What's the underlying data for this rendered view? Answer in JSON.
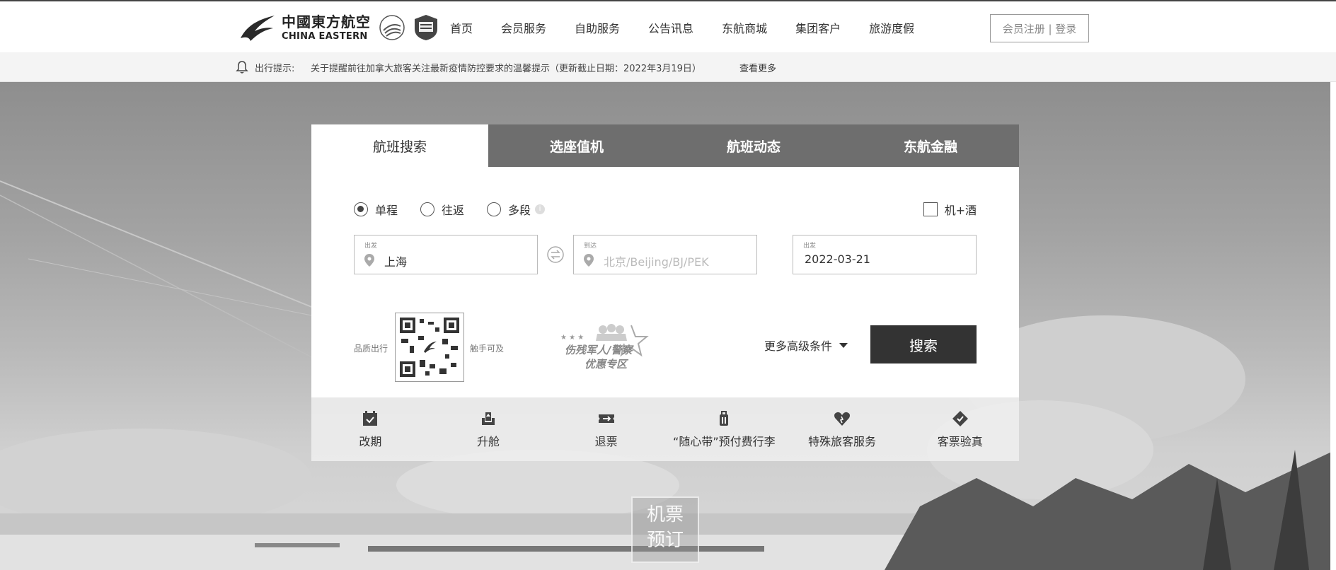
{
  "brand": {
    "name_cn": "中國東方航空",
    "name_en": "CHINA EASTERN"
  },
  "nav": {
    "items": [
      "首页",
      "会员服务",
      "自助服务",
      "公告讯息",
      "东航商城",
      "集团客户",
      "旅游度假"
    ],
    "login": "会员注册 | 登录"
  },
  "notice": {
    "label": "出行提示:",
    "text": "关于提醒前往加拿大旅客关注最新疫情防控要求的温馨提示（更新截止日期：2022年3月19日）",
    "more": "查看更多"
  },
  "search": {
    "tabs": [
      "航班搜索",
      "选座值机",
      "航班动态",
      "东航金融"
    ],
    "active_tab": 0,
    "trip_types": [
      "单程",
      "往返",
      "多段"
    ],
    "selected_trip": "单程",
    "hotel_option": "机+酒",
    "from_label": "出发",
    "from_value": "上海",
    "to_label": "到达",
    "to_placeholder": "北京/Beijing/BJ/PEK",
    "date_label": "出发",
    "date_value": "2022-03-21",
    "qr_left": "品质出行",
    "qr_right": "触手可及",
    "veteran_line1": "伤残军人/警察",
    "veteran_line2": "优惠专区",
    "more_conditions": "更多高级条件",
    "search_button": "搜索"
  },
  "services": [
    {
      "label": "改期",
      "icon": "calendar-icon"
    },
    {
      "label": "升舱",
      "icon": "upgrade-seat-icon"
    },
    {
      "label": "退票",
      "icon": "refund-ticket-icon"
    },
    {
      "label": "“随心带”预付费行李",
      "icon": "luggage-icon"
    },
    {
      "label": "特殊旅客服务",
      "icon": "heart-hand-icon"
    },
    {
      "label": "客票验真",
      "icon": "ticket-verify-icon"
    }
  ],
  "promo": {
    "line1": "机票",
    "line2": "预订"
  }
}
